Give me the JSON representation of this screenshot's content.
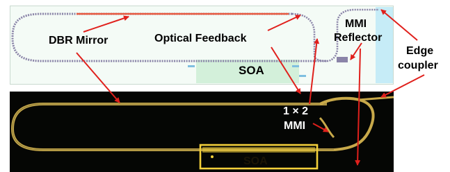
{
  "labels": {
    "dbr_mirror": "DBR Mirror",
    "optical_feedback": "Optical Feedback",
    "mmi_reflector_line1": "MMI",
    "mmi_reflector_line2": "Reflector",
    "edge_coupler_line1": "Edge",
    "edge_coupler_line2": "coupler",
    "soa_top": "SOA",
    "mmi_1x2_line1": "1 × 2",
    "mmi_1x2_line2": "MMI",
    "soa_bottom": "SOA"
  },
  "colors": {
    "arrow": "#e0201c",
    "layout_waveguide": "#8a84a8",
    "dbr_grating": "#e8593f",
    "layout_bg": "#f4fbf6",
    "soa_region": "#d3f0da",
    "coupler_region": "#c6ecf7",
    "micrograph_bg": "#050604",
    "waveguide_gold": "#c8a94a",
    "soa_gold": "#f2cf3a"
  }
}
